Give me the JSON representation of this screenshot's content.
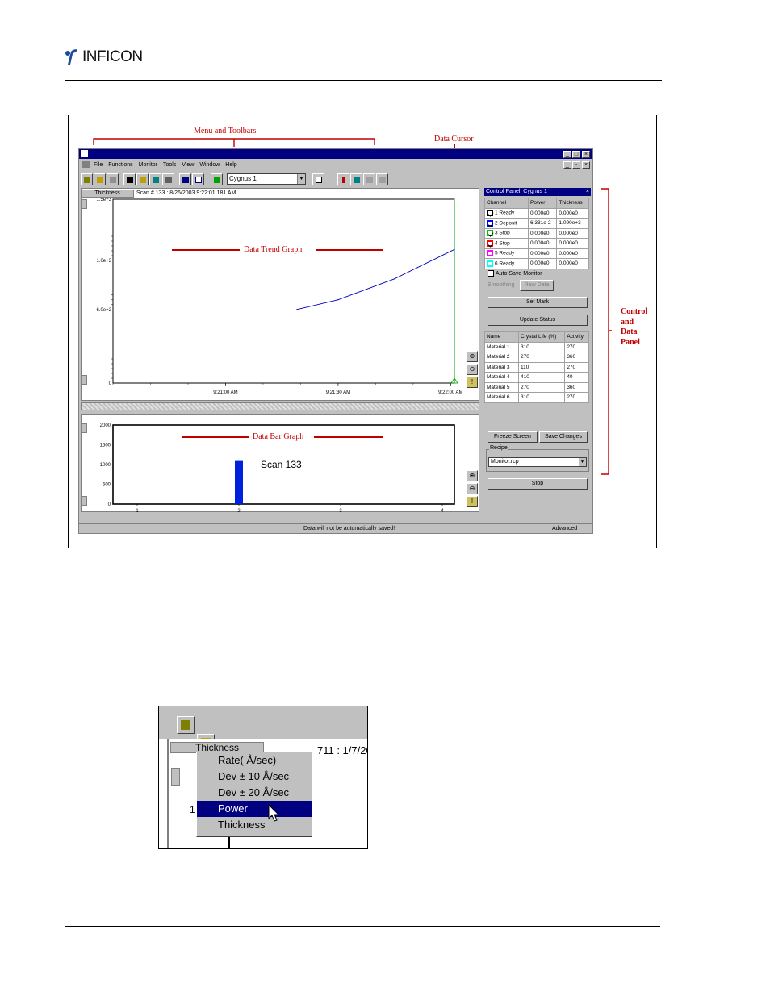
{
  "header": {
    "logo": "INFICON"
  },
  "callouts": {
    "menu_toolbars": "Menu and Toolbars",
    "data_cursor": "Data Cursor",
    "trend_graph": "Data Trend Graph",
    "bar_graph": "Data Bar Graph",
    "control_panel_1": "Control",
    "control_panel_2": "and",
    "control_panel_3": "Data",
    "control_panel_4": "Panel"
  },
  "app": {
    "menu": [
      "File",
      "Functions",
      "Monitor",
      "Tools",
      "View",
      "Window",
      "Help"
    ],
    "selected_monitor": "Cygnus 1",
    "trend": {
      "tab": "Thickness",
      "scan_info": "Scan #   133 : 8/26/2003 9:22:01.181 AM",
      "y_ticks": [
        "1.5e+3",
        "1.0e+3",
        "6.0e+2",
        "0"
      ],
      "x_ticks": [
        "9:21:00 AM",
        "9:21:30 AM",
        "9:22:00 AM"
      ]
    },
    "bars": {
      "label": "Scan 133",
      "y_ticks": [
        "2000",
        "1500",
        "1000",
        "500",
        "0"
      ],
      "x_ticks": [
        "1",
        "2",
        "3",
        "4"
      ]
    },
    "control_panel": {
      "title": "Control Panel: Cygnus 1",
      "headers": [
        "Channel",
        "Power",
        "Thickness"
      ],
      "channels": [
        {
          "name": "1 Ready",
          "power": "0.000e0",
          "thickness": "0.000e0",
          "checked": true,
          "color": "#000000"
        },
        {
          "name": "2 Deposit",
          "power": "6.331e-2",
          "thickness": "1.090e+3",
          "checked": true,
          "color": "#0000ff"
        },
        {
          "name": "3 Stop",
          "power": "0.000e0",
          "thickness": "0.000e0",
          "checked": true,
          "color": "#00c000"
        },
        {
          "name": "4 Stop",
          "power": "0.000e0",
          "thickness": "0.000e0",
          "checked": true,
          "color": "#ff0000"
        },
        {
          "name": "5 Ready",
          "power": "0.000e0",
          "thickness": "0.000e0",
          "checked": false,
          "color": "#ff00ff"
        },
        {
          "name": "6 Ready",
          "power": "0.000e0",
          "thickness": "0.000e0",
          "checked": false,
          "color": "#00ffff"
        }
      ],
      "auto_save": "Auto Save Monitor",
      "smoothing": "Smoothing",
      "raw_data": "Raw Data",
      "set_mark": "Set Mark",
      "update_status": "Update Status",
      "material_headers": [
        "Name",
        "Crystal Life (%)",
        "Activity"
      ],
      "materials": [
        {
          "name": "Material 1",
          "life": "310",
          "activity": "270"
        },
        {
          "name": "Material 2",
          "life": "270",
          "activity": "360"
        },
        {
          "name": "Material 3",
          "life": "110",
          "activity": "270"
        },
        {
          "name": "Material 4",
          "life": "410",
          "activity": "40"
        },
        {
          "name": "Material 5",
          "life": "270",
          "activity": "360"
        },
        {
          "name": "Material 6",
          "life": "310",
          "activity": "270"
        }
      ],
      "freeze_screen": "Freeze Screen",
      "save_changes": "Save Changes",
      "recipe_label": "Recipe",
      "recipe_value": "Monitor.rcp",
      "stop": "Stop"
    },
    "status": {
      "message": "Data will not be automatically saved!",
      "mode": "Advanced"
    }
  },
  "popup": {
    "tab": "Thickness",
    "scan_fragment": "711 : 1/7/20",
    "axis_fragment": "1",
    "items": [
      "Rate( Å/sec)",
      "Dev ± 10 Å/sec",
      "Dev ± 20 Å/sec",
      "Power",
      "Thickness"
    ],
    "selected_index": 3
  },
  "chart_data": [
    {
      "type": "line",
      "x": [
        "9:21:19 AM",
        "9:21:30 AM",
        "9:21:45 AM",
        "9:22:01 AM"
      ],
      "y": [
        600,
        680,
        850,
        1090
      ],
      "ylim": [
        0,
        1500
      ],
      "xlabel": "",
      "ylabel": "",
      "title": ""
    },
    {
      "type": "bar",
      "categories": [
        "1",
        "2",
        "3",
        "4"
      ],
      "values": [
        0,
        1090,
        0,
        0
      ],
      "ylim": [
        0,
        2000
      ],
      "title": "Scan 133"
    }
  ]
}
